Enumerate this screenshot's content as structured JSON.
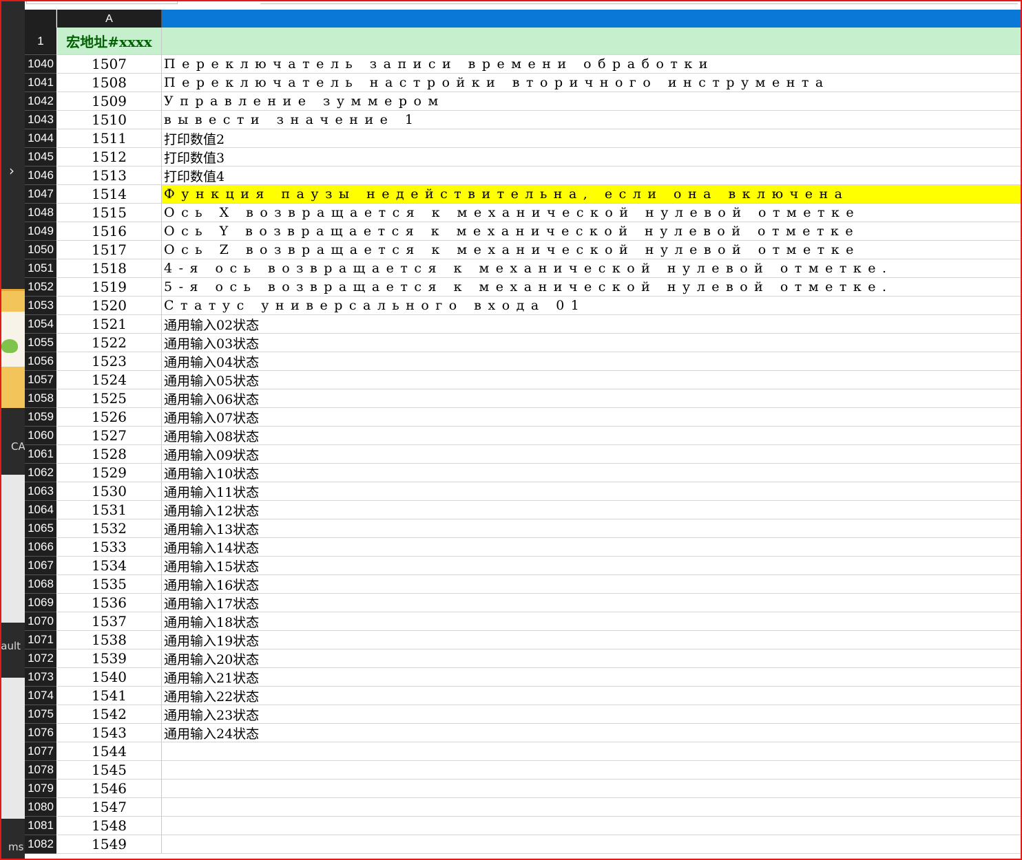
{
  "sheet": {
    "column_header": "A",
    "header_row": {
      "row_number": "1",
      "col_a": "宏地址#xxxx",
      "col_b": ""
    },
    "rows": [
      {
        "n": "1040",
        "a": "1507",
        "b": "Переключатель записи времени обработки",
        "spaced": true
      },
      {
        "n": "1041",
        "a": "1508",
        "b": "Переключатель настройки вторичного инструмента",
        "spaced": true
      },
      {
        "n": "1042",
        "a": "1509",
        "b": "Управление зуммером",
        "spaced": true
      },
      {
        "n": "1043",
        "a": "1510",
        "b": "вывести значение 1",
        "spaced": true
      },
      {
        "n": "1044",
        "a": "1511",
        "b": "打印数值2"
      },
      {
        "n": "1045",
        "a": "1512",
        "b": "打印数值3"
      },
      {
        "n": "1046",
        "a": "1513",
        "b": "打印数值4"
      },
      {
        "n": "1047",
        "a": "1514",
        "b": "Функция паузы недействительна, если она включена",
        "spaced": true,
        "highlight": "#ffff00"
      },
      {
        "n": "1048",
        "a": "1515",
        "b": "Ось X возвращается к механической нулевой отметке",
        "spaced": true
      },
      {
        "n": "1049",
        "a": "1516",
        "b": "Ось Y возвращается к механической нулевой отметке",
        "spaced": true
      },
      {
        "n": "1050",
        "a": "1517",
        "b": "Ось Z возвращается к механической нулевой отметке",
        "spaced": true
      },
      {
        "n": "1051",
        "a": "1518",
        "b": "4-я ось возвращается к механической нулевой отметке.",
        "spaced": true
      },
      {
        "n": "1052",
        "a": "1519",
        "b": "5-я ось возвращается к механической нулевой отметке.",
        "spaced": true
      },
      {
        "n": "1053",
        "a": "1520",
        "b": "Статус универсального входа 01",
        "spaced": true
      },
      {
        "n": "1054",
        "a": "1521",
        "b": "通用输入02状态"
      },
      {
        "n": "1055",
        "a": "1522",
        "b": "通用输入03状态"
      },
      {
        "n": "1056",
        "a": "1523",
        "b": "通用输入04状态"
      },
      {
        "n": "1057",
        "a": "1524",
        "b": "通用输入05状态"
      },
      {
        "n": "1058",
        "a": "1525",
        "b": "通用输入06状态"
      },
      {
        "n": "1059",
        "a": "1526",
        "b": "通用输入07状态"
      },
      {
        "n": "1060",
        "a": "1527",
        "b": "通用输入08状态"
      },
      {
        "n": "1061",
        "a": "1528",
        "b": "通用输入09状态"
      },
      {
        "n": "1062",
        "a": "1529",
        "b": "通用输入10状态"
      },
      {
        "n": "1063",
        "a": "1530",
        "b": "通用输入11状态"
      },
      {
        "n": "1064",
        "a": "1531",
        "b": "通用输入12状态"
      },
      {
        "n": "1065",
        "a": "1532",
        "b": "通用输入13状态"
      },
      {
        "n": "1066",
        "a": "1533",
        "b": "通用输入14状态"
      },
      {
        "n": "1067",
        "a": "1534",
        "b": "通用输入15状态"
      },
      {
        "n": "1068",
        "a": "1535",
        "b": "通用输入16状态"
      },
      {
        "n": "1069",
        "a": "1536",
        "b": "通用输入17状态"
      },
      {
        "n": "1070",
        "a": "1537",
        "b": "通用输入18状态"
      },
      {
        "n": "1071",
        "a": "1538",
        "b": "通用输入19状态"
      },
      {
        "n": "1072",
        "a": "1539",
        "b": "通用输入20状态"
      },
      {
        "n": "1073",
        "a": "1540",
        "b": "通用输入21状态"
      },
      {
        "n": "1074",
        "a": "1541",
        "b": "通用输入22状态"
      },
      {
        "n": "1075",
        "a": "1542",
        "b": "通用输入23状态"
      },
      {
        "n": "1076",
        "a": "1543",
        "b": "通用输入24状态"
      },
      {
        "n": "1077",
        "a": "1544",
        "b": ""
      },
      {
        "n": "1078",
        "a": "1545",
        "b": ""
      },
      {
        "n": "1079",
        "a": "1546",
        "b": ""
      },
      {
        "n": "1080",
        "a": "1547",
        "b": ""
      },
      {
        "n": "1081",
        "a": "1548",
        "b": ""
      },
      {
        "n": "1082",
        "a": "1549",
        "b": ""
      }
    ]
  },
  "background": {
    "chevron": "›",
    "label_ca": "CA",
    "label_fault": "fault",
    "label_ms": "ms"
  },
  "colors": {
    "header_fill": "#c6efce",
    "header_text": "#006100",
    "selected_column": "#0a78d7",
    "highlight": "#ffff00",
    "outline": "#e11a1a"
  }
}
